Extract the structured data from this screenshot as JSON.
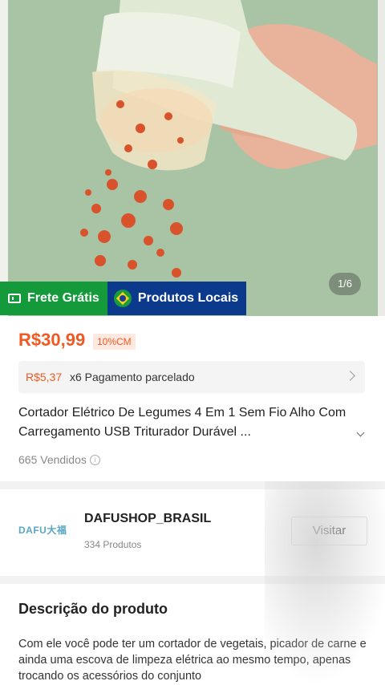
{
  "gallery": {
    "counter": "1/6"
  },
  "badges": {
    "free_shipping": "Frete Grátis",
    "local_products": "Produtos Locais"
  },
  "product": {
    "price": "R$30,99",
    "discount": "10%CM",
    "installment_amount": "R$5,37",
    "installment_text": "x6 Pagamento parcelado",
    "title": "Cortador Elétrico De Legumes 4 Em 1 Sem Fio Alho Com Carregamento USB Triturador Durável ...",
    "sold": "665 Vendidos"
  },
  "shop": {
    "logo_text": "DAFU大福",
    "name": "DAFUSHOP_BRASIL",
    "products": "334 Produtos",
    "visit_label": "Visitar"
  },
  "description": {
    "title": "Descrição do produto",
    "body": "Com ele você pode ter um cortador de vegetais, picador de carne e ainda uma escova de limpeza elétrica ao mesmo tempo, apenas trocando os acessórios do conjunto"
  },
  "colors": {
    "price_orange": "#f05a22",
    "free_shipping_green": "#149a3a",
    "local_blue": "#0b3a8c"
  }
}
